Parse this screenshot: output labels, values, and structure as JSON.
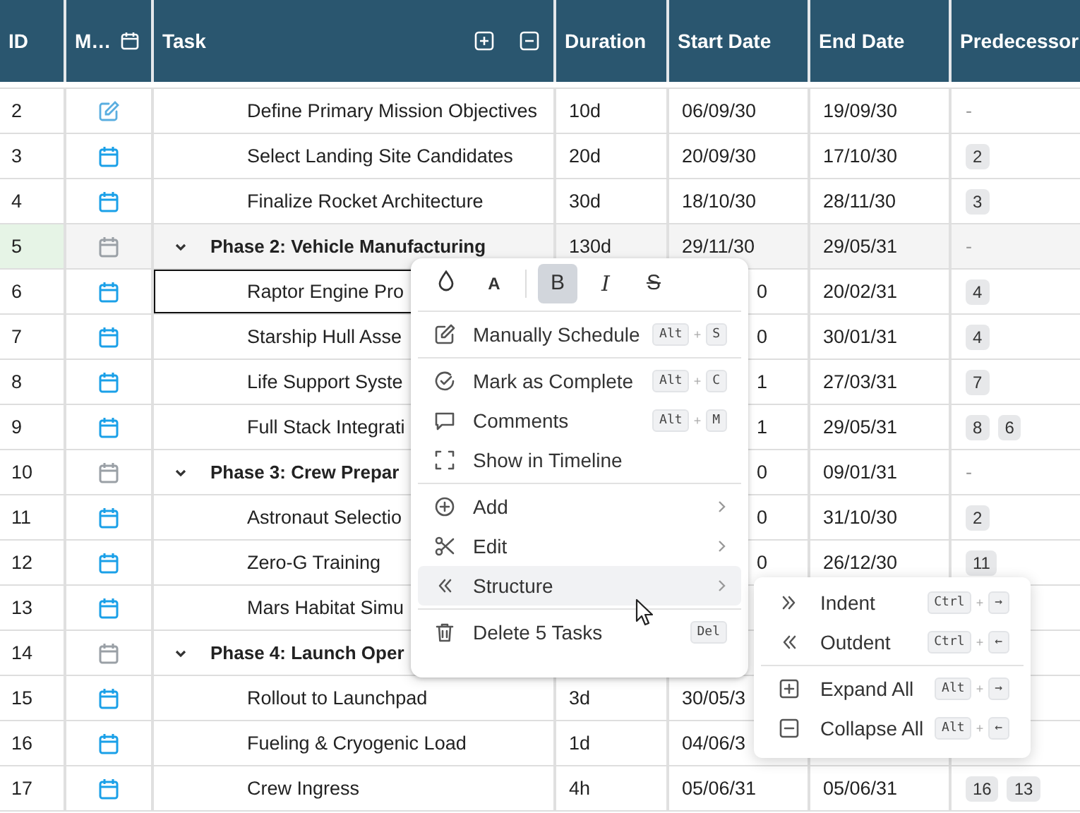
{
  "columns": [
    {
      "kind": "id",
      "label": "ID"
    },
    {
      "kind": "mode",
      "label": "M…"
    },
    {
      "kind": "task",
      "label": "Task"
    },
    {
      "kind": "text",
      "label": "Duration"
    },
    {
      "kind": "text",
      "label": "Start Date"
    },
    {
      "kind": "text",
      "label": "End Date"
    },
    {
      "kind": "text",
      "label": "Predecessor"
    }
  ],
  "rows": [
    {
      "id": "2",
      "kind": "manual",
      "selected": false,
      "focused": false,
      "task": "Define Primary Mission Objectives",
      "duration": "10d",
      "start": "06/09/30",
      "end": "19/09/30",
      "predecessor_text": "-"
    },
    {
      "id": "3",
      "kind": "auto",
      "selected": false,
      "focused": false,
      "task": "Select Landing Site Candidates",
      "duration": "20d",
      "start": "20/09/30",
      "end": "17/10/30",
      "predecessors": [
        "2"
      ]
    },
    {
      "id": "4",
      "kind": "auto",
      "selected": false,
      "focused": false,
      "task": "Finalize Rocket Architecture",
      "duration": "30d",
      "start": "18/10/30",
      "end": "28/11/30",
      "predecessors": [
        "3"
      ]
    },
    {
      "id": "5",
      "kind": "summary",
      "expanded": true,
      "selected": true,
      "focused": false,
      "task": "Phase 2: Vehicle Manufacturing",
      "duration": "130d",
      "start": "29/11/30",
      "end": "29/05/31",
      "predecessor_text": "-"
    },
    {
      "id": "6",
      "kind": "auto",
      "selected": false,
      "focused": true,
      "task": "Raptor Engine Pro",
      "start": "0",
      "start_cut": true,
      "end": "20/02/31",
      "predecessors": [
        "4"
      ]
    },
    {
      "id": "7",
      "kind": "auto",
      "selected": false,
      "focused": false,
      "task": "Starship Hull Asse",
      "start": "0",
      "start_cut": true,
      "end": "30/01/31",
      "predecessors": [
        "4"
      ]
    },
    {
      "id": "8",
      "kind": "auto",
      "selected": false,
      "focused": false,
      "task": "Life Support Syste",
      "start": "1",
      "start_cut": true,
      "end": "27/03/31",
      "predecessors": [
        "7"
      ]
    },
    {
      "id": "9",
      "kind": "auto",
      "selected": false,
      "focused": false,
      "task": "Full Stack Integrati",
      "start": "1",
      "start_cut": true,
      "end": "29/05/31",
      "predecessors": [
        "8",
        "6"
      ]
    },
    {
      "id": "10",
      "kind": "summary",
      "expanded": true,
      "selected": false,
      "focused": false,
      "task": "Phase 3: Crew Prepar",
      "start": "0",
      "start_cut": true,
      "end": "09/01/31",
      "predecessor_text": "-"
    },
    {
      "id": "11",
      "kind": "auto",
      "selected": false,
      "focused": false,
      "task": "Astronaut Selectio",
      "start": "0",
      "start_cut": true,
      "end": "31/10/30",
      "predecessors": [
        "2"
      ]
    },
    {
      "id": "12",
      "kind": "auto",
      "selected": false,
      "focused": false,
      "task": "Zero-G Training",
      "start": "0",
      "start_cut": true,
      "end": "26/12/30",
      "predecessors": [
        "11"
      ]
    },
    {
      "id": "13",
      "kind": "auto",
      "selected": false,
      "focused": false,
      "task": "Mars Habitat Simu"
    },
    {
      "id": "14",
      "kind": "summary",
      "expanded": true,
      "selected": false,
      "focused": false,
      "task": "Phase 4: Launch Oper"
    },
    {
      "id": "15",
      "kind": "auto",
      "selected": false,
      "focused": false,
      "task": "Rollout to Launchpad",
      "duration": "3d",
      "start": "30/05/3"
    },
    {
      "id": "16",
      "kind": "auto",
      "selected": false,
      "focused": false,
      "task": "Fueling & Cryogenic Load",
      "duration": "1d",
      "start": "04/06/3"
    },
    {
      "id": "17",
      "kind": "auto",
      "selected": false,
      "focused": false,
      "task": "Crew Ingress",
      "duration": "4h",
      "start": "05/06/31",
      "end": "05/06/31",
      "predecessors": [
        "16",
        "13"
      ]
    }
  ],
  "context_menu": {
    "toolbar": [
      {
        "kind": "fill",
        "selected": false
      },
      {
        "kind": "color",
        "label": "A",
        "selected": false
      },
      {
        "kind": "bold",
        "label": "B",
        "selected": true
      },
      {
        "kind": "italic",
        "label": "I",
        "selected": false
      },
      {
        "kind": "strike",
        "label": "S",
        "selected": false
      }
    ],
    "sections": [
      [
        {
          "label": "Manually Schedule",
          "shortcut": [
            "Alt",
            "+",
            "S"
          ],
          "submenu": false,
          "selected": false
        }
      ],
      [
        {
          "label": "Mark as Complete",
          "shortcut": [
            "Alt",
            "+",
            "C"
          ],
          "submenu": false,
          "selected": false
        },
        {
          "label": "Comments",
          "shortcut": [
            "Alt",
            "+",
            "M"
          ],
          "submenu": false,
          "selected": false
        },
        {
          "label": "Show in Timeline",
          "submenu": false,
          "selected": false
        }
      ],
      [
        {
          "label": "Add",
          "submenu": true,
          "selected": false
        },
        {
          "label": "Edit",
          "submenu": true,
          "selected": false
        },
        {
          "label": "Structure",
          "submenu": true,
          "selected": true
        }
      ],
      [
        {
          "label": "Delete 5 Tasks",
          "shortcut": [
            "Del"
          ],
          "submenu": false,
          "selected": false
        }
      ]
    ]
  },
  "submenu": {
    "sections": [
      [
        {
          "label": "Indent",
          "shortcut": [
            "Ctrl",
            "+",
            "→"
          ]
        },
        {
          "label": "Outdent",
          "shortcut": [
            "Ctrl",
            "+",
            "←"
          ]
        }
      ],
      [
        {
          "label": "Expand All",
          "shortcut": [
            "Alt",
            "+",
            "→"
          ]
        },
        {
          "label": "Collapse All",
          "shortcut": [
            "Alt",
            "+",
            "←"
          ]
        }
      ]
    ]
  }
}
